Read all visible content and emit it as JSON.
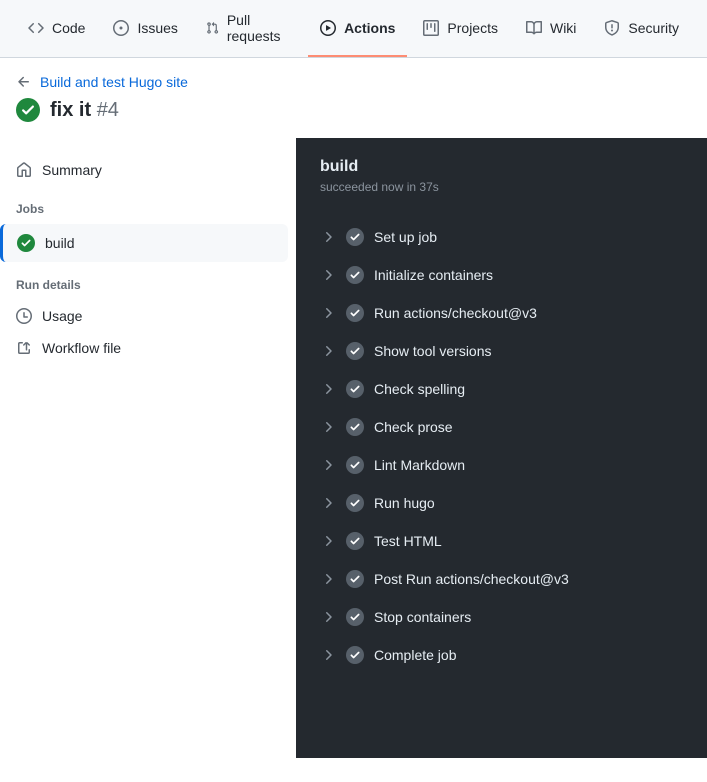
{
  "tabs": [
    {
      "label": "Code"
    },
    {
      "label": "Issues"
    },
    {
      "label": "Pull requests"
    },
    {
      "label": "Actions"
    },
    {
      "label": "Projects"
    },
    {
      "label": "Wiki"
    },
    {
      "label": "Security"
    }
  ],
  "breadcrumb": "Build and test Hugo site",
  "run": {
    "title": "fix it",
    "number": "#4"
  },
  "sidebar": {
    "summary": "Summary",
    "jobs_heading": "Jobs",
    "job_name": "build",
    "details_heading": "Run details",
    "usage": "Usage",
    "workflow": "Workflow file"
  },
  "job": {
    "name": "build",
    "status": "succeeded now in 37s",
    "steps": [
      "Set up job",
      "Initialize containers",
      "Run actions/checkout@v3",
      "Show tool versions",
      "Check spelling",
      "Check prose",
      "Lint Markdown",
      "Run hugo",
      "Test HTML",
      "Post Run actions/checkout@v3",
      "Stop containers",
      "Complete job"
    ]
  }
}
